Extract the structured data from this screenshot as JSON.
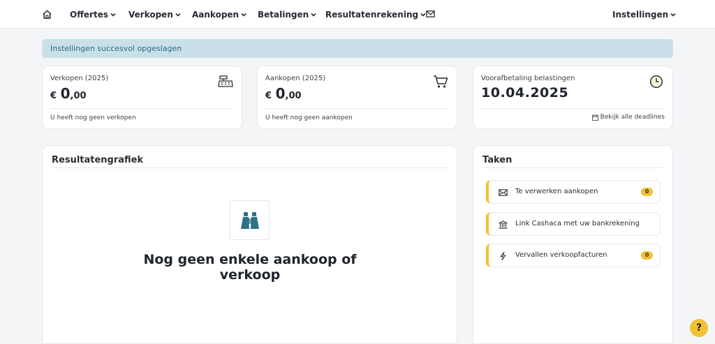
{
  "nav": {
    "items": [
      {
        "label": "Offertes"
      },
      {
        "label": "Verkopen"
      },
      {
        "label": "Aankopen"
      },
      {
        "label": "Betalingen"
      },
      {
        "label": "Resultatenrekening"
      }
    ],
    "settings_label": "Instellingen"
  },
  "alert": {
    "message": "Instellingen succesvol opgeslagen"
  },
  "stats": {
    "sales": {
      "label": "Verkopen (2025)",
      "currency": "€",
      "integer": "0",
      "decimals": ",00",
      "footer": "U heeft nog geen verkopen"
    },
    "purchases": {
      "label": "Aankopen (2025)",
      "currency": "€",
      "integer": "0",
      "decimals": ",00",
      "footer": "U heeft nog geen aankopen"
    },
    "taxes": {
      "label": "Voorafbetaling belastingen",
      "date": "10.04.2025",
      "link": "Bekijk alle deadlines"
    }
  },
  "chart_panel": {
    "title": "Resultatengrafiek",
    "empty_message": "Nog geen enkele aankoop of verkoop"
  },
  "tasks": {
    "title": "Taken",
    "items": [
      {
        "label": "Te verwerken aankopen",
        "count": "0",
        "icon": "envelope-icon"
      },
      {
        "label": "Link Cashaca met uw bankrekening",
        "icon": "bank-icon"
      },
      {
        "label": "Vervallen verkoopfacturen",
        "count": "0",
        "icon": "lightning-icon"
      }
    ]
  },
  "help": {
    "label": "?"
  },
  "colors": {
    "accent": "#f3c234",
    "alert_bg": "#c9e0e8",
    "alert_text": "#2a6e86",
    "brand_teal": "#2f6f87"
  }
}
